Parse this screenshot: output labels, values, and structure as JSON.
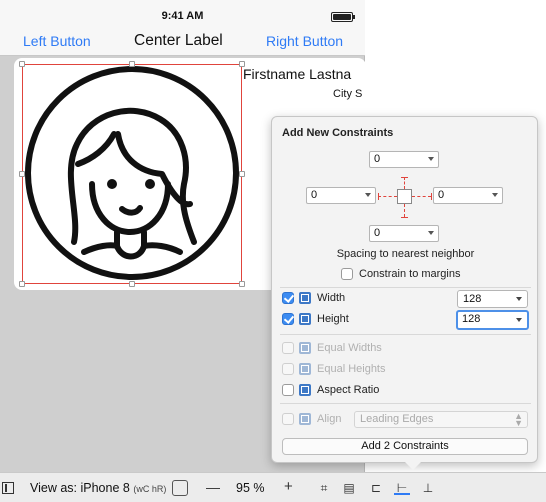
{
  "status_bar": {
    "time": "9:41 AM"
  },
  "navbar": {
    "left_button": "Left Button",
    "center_label": "Center Label",
    "right_button": "Right Button"
  },
  "card": {
    "name": "Firstname Lastna",
    "city": "City S",
    "avatar_icon": "person-avatar-icon"
  },
  "constraints_popover": {
    "title": "Add New Constraints",
    "spacing": {
      "top": "0",
      "left": "0",
      "right": "0",
      "bottom": "0"
    },
    "spacing_label": "Spacing to nearest neighbor",
    "constrain_to_margins": {
      "label": "Constrain to margins",
      "checked": false
    },
    "width": {
      "label": "Width",
      "checked": true,
      "value": "128"
    },
    "height": {
      "label": "Height",
      "checked": true,
      "value": "128"
    },
    "equal_widths": {
      "label": "Equal Widths",
      "enabled": false
    },
    "equal_heights": {
      "label": "Equal Heights",
      "enabled": false
    },
    "aspect_ratio": {
      "label": "Aspect Ratio",
      "checked": false
    },
    "align": {
      "label": "Align",
      "value": "Leading Edges",
      "enabled": false
    },
    "add_button": "Add 2 Constraints"
  },
  "bottom_toolbar": {
    "view_as": "View as: iPhone 8",
    "size_class": "(wC hR)",
    "zoom_out": "—",
    "zoom_level": "95 %",
    "zoom_in": "+",
    "icons": [
      "embed-in-stack-icon",
      "update-frames-icon",
      "align-icon",
      "add-constraints-icon",
      "resolve-issues-icon"
    ]
  },
  "colors": {
    "accent": "#2f7bf5",
    "constraint_red": "#e0443c",
    "checkbox_blue": "#3c8cf2"
  }
}
